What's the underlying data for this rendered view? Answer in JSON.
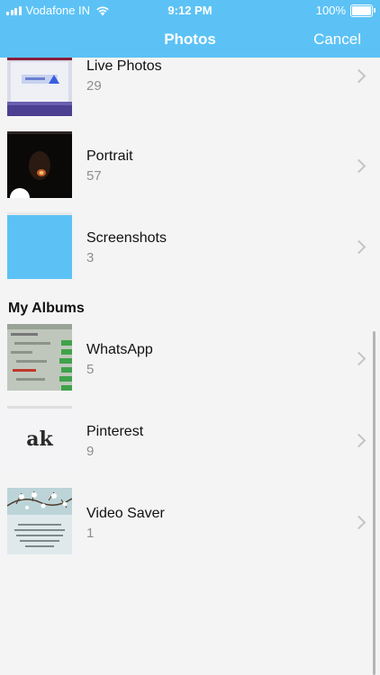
{
  "status_bar": {
    "carrier": "Vodafone IN",
    "time": "9:12 PM",
    "battery": "100%"
  },
  "nav": {
    "title": "Photos",
    "cancel_label": "Cancel"
  },
  "albums_top": [
    {
      "name": "Live Photos",
      "count": "29"
    },
    {
      "name": "Portrait",
      "count": "57"
    },
    {
      "name": "Screenshots",
      "count": "3"
    }
  ],
  "section": {
    "title": "My Albums"
  },
  "albums_my": [
    {
      "name": "WhatsApp",
      "count": "5"
    },
    {
      "name": "Pinterest",
      "count": "9"
    },
    {
      "name": "Video Saver",
      "count": "1"
    }
  ],
  "thumbnails": {
    "pinterest_logo_text": "ak"
  },
  "colors": {
    "header_bg": "#5cc2f5",
    "screenshot_thumb": "#5cc2f5",
    "background": "#f4f4f4"
  }
}
